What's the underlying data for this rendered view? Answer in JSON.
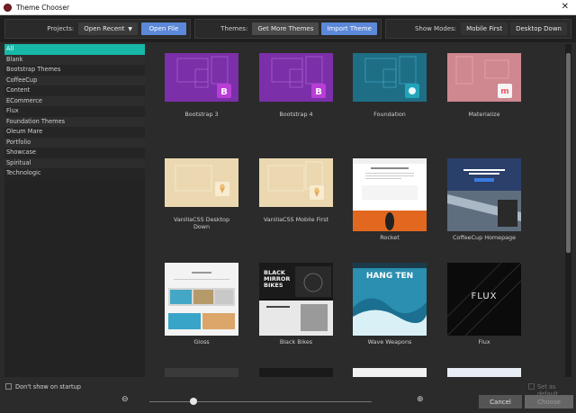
{
  "window": {
    "title": "Theme Chooser",
    "close_glyph": "✕"
  },
  "toolbar": {
    "projects_label": "Projects:",
    "projects_dropdown": "Open Recent",
    "open_file": "Open File",
    "themes_label": "Themes:",
    "get_more_themes": "Get More Themes",
    "import_theme": "Import Theme",
    "show_modes_label": "Show Modes:",
    "mobile_first": "Mobile First",
    "desktop_down": "Desktop Down"
  },
  "sidebar": {
    "items": [
      {
        "label": "All",
        "selected": true
      },
      {
        "label": "Blank"
      },
      {
        "label": "Bootstrap Themes"
      },
      {
        "label": "CoffeeCup"
      },
      {
        "label": "Content"
      },
      {
        "label": "ECommerce"
      },
      {
        "label": "Flux"
      },
      {
        "label": "Foundation Themes"
      },
      {
        "label": "Oleum Mare"
      },
      {
        "label": "Portfolio"
      },
      {
        "label": "Showcase"
      },
      {
        "label": "Spiritual"
      },
      {
        "label": "Technologic"
      }
    ]
  },
  "themes": [
    {
      "label": "Bootstrap 3",
      "bg": "#7b2fa8",
      "badge": "B",
      "badge_color": "#b93dd6",
      "icon": "bootstrap-logo-icon"
    },
    {
      "label": "Bootstrap 4",
      "bg": "#7b2fa8",
      "badge": "B",
      "badge_color": "#b93dd6",
      "icon": "bootstrap-logo-icon"
    },
    {
      "label": "Foundation",
      "bg": "#1e6e86",
      "badge": "",
      "badge_color": "#21a4b8",
      "icon": "foundation-logo-icon"
    },
    {
      "label": "Materialize",
      "bg": "#cf8790",
      "badge": "m",
      "badge_color": "#e65a68",
      "icon": "materialize-logo-icon"
    },
    {
      "label": "VanillaCSS Desktop Down",
      "bg": "#ebd8b0",
      "badge": "",
      "badge_color": "#f2e4c6",
      "icon": "icecream-icon"
    },
    {
      "label": "VanillaCSS Mobile First",
      "bg": "#ebd8b0",
      "badge": "",
      "badge_color": "#f2e4c6",
      "icon": "icecream-icon"
    },
    {
      "label": "Rocket",
      "bg": "#ffffff",
      "icon": "rocket-preview"
    },
    {
      "label": "CoffeeCup Homepage",
      "bg": "#1d1d1d",
      "icon": "coffeecup-preview"
    },
    {
      "label": "Gloss",
      "bg": "#f3f3f3",
      "icon": "gloss-preview"
    },
    {
      "label": "Black Bikes",
      "bg": "#141414",
      "preview_text": "BLACK MIRROR BIKES",
      "icon": "blackbikes-preview"
    },
    {
      "label": "Wave Weapons",
      "bg": "#2a8fb0",
      "preview_text": "HANG TEN",
      "icon": "wave-preview"
    },
    {
      "label": "Flux",
      "bg": "#0b0b0b",
      "preview_text": "FLUX",
      "icon": "flux-preview"
    }
  ],
  "bottom": {
    "dont_show": "Don't show on startup",
    "set_default": "Set as default",
    "cancel": "Cancel",
    "choose": "Choose",
    "zoom_out_glyph": "⊖",
    "zoom_in_glyph": "⊕"
  }
}
